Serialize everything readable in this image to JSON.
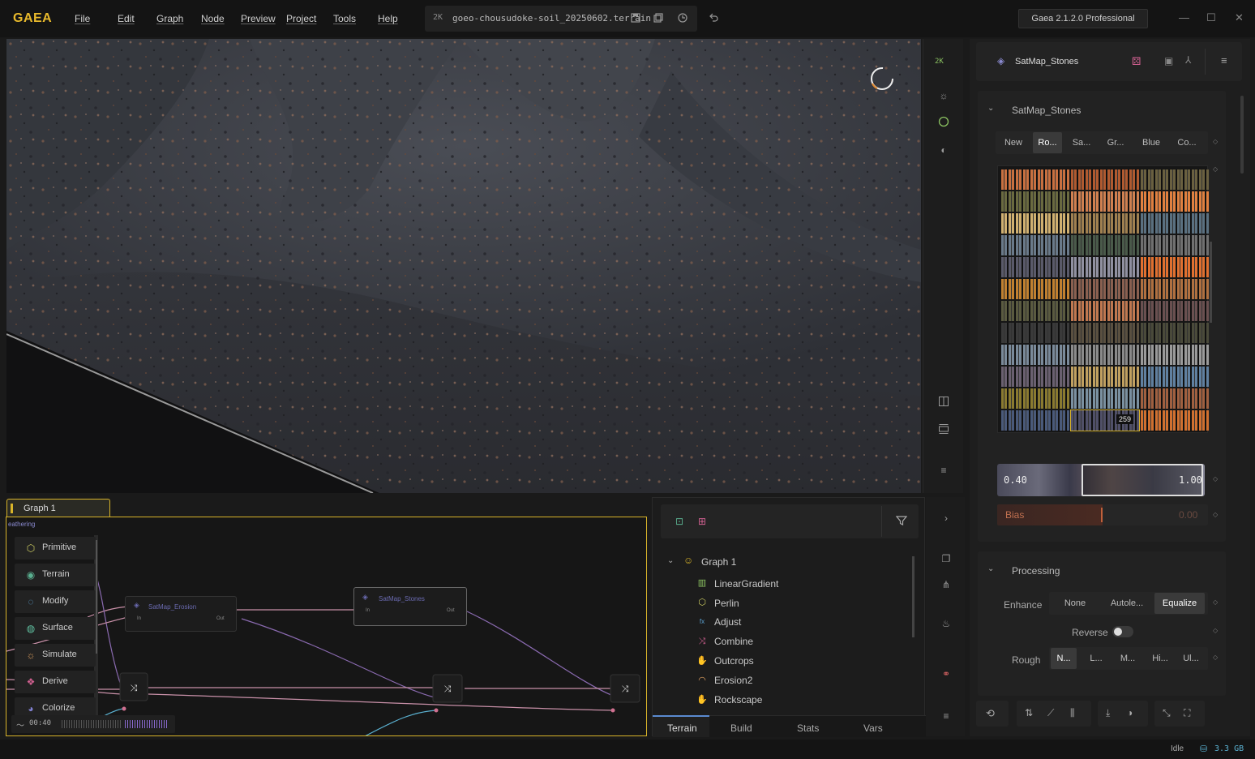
{
  "app": {
    "logo": "GAEA",
    "menu": [
      "File",
      "Edit",
      "Graph",
      "Node",
      "Preview",
      "Project",
      "Tools",
      "Help"
    ],
    "resolution_badge": "2K",
    "file_name": "goeo-chousudoke-soil_20250602.terrain",
    "version": "Gaea 2.1.2.0 Professional"
  },
  "viewport": {
    "toolbar_badge": "2K"
  },
  "graph": {
    "tab_label": "Graph 1",
    "category_header": "eathering",
    "categories": [
      {
        "label": "Primitive",
        "icon": "cube-icon",
        "color": "#c8c860"
      },
      {
        "label": "Terrain",
        "icon": "terrain-icon",
        "color": "#5ab090"
      },
      {
        "label": "Modify",
        "icon": "modify-icon",
        "color": "#5aa0d0"
      },
      {
        "label": "Surface",
        "icon": "surface-icon",
        "color": "#60c0a0"
      },
      {
        "label": "Simulate",
        "icon": "simulate-icon",
        "color": "#e0a060"
      },
      {
        "label": "Derive",
        "icon": "derive-icon",
        "color": "#d06090"
      },
      {
        "label": "Colorize",
        "icon": "colorize-icon",
        "color": "#8080d0"
      }
    ],
    "nodes": [
      {
        "title": "SatMap_Erosion",
        "in": "In",
        "out": "Out"
      },
      {
        "title": "SatMap_Stones",
        "in": "In",
        "out": "Out"
      }
    ],
    "timer": "00:40"
  },
  "tree": {
    "root": "Graph 1",
    "items": [
      {
        "label": "LinearGradient",
        "icon": "gradient-icon",
        "color": "#8ac060"
      },
      {
        "label": "Perlin",
        "icon": "hexagon-icon",
        "color": "#c8c860"
      },
      {
        "label": "Adjust",
        "icon": "fx-icon",
        "color": "#5aa0d0"
      },
      {
        "label": "Combine",
        "icon": "combine-icon",
        "color": "#d06090"
      },
      {
        "label": "Outcrops",
        "icon": "hand-icon",
        "color": "#5ab090"
      },
      {
        "label": "Erosion2",
        "icon": "erosion-icon",
        "color": "#e0a060"
      },
      {
        "label": "Rockscape",
        "icon": "hand-icon",
        "color": "#5ab090"
      }
    ],
    "tabs": [
      "Terrain",
      "Build",
      "Stats",
      "Vars"
    ]
  },
  "properties": {
    "node_title": "SatMap_Stones",
    "section_title": "SatMap_Stones",
    "library_tabs": [
      "New",
      "Ro...",
      "Sa...",
      "Gr...",
      "Blue",
      "Co..."
    ],
    "active_library_tab": 1,
    "selected_swatch_label": "259",
    "range_min": "0.40",
    "range_max": "1.00",
    "bias_label": "Bias",
    "bias_value": "0.00",
    "processing_title": "Processing",
    "enhance_label": "Enhance",
    "enhance_options": [
      "None",
      "Autole...",
      "Equalize"
    ],
    "enhance_active": 2,
    "reverse_label": "Reverse",
    "rough_label": "Rough",
    "rough_options": [
      "N...",
      "L...",
      "M...",
      "Hi...",
      "Ul..."
    ],
    "rough_active": 0
  },
  "status": {
    "state": "Idle",
    "memory": "3.3 GB"
  },
  "palette_colors": [
    [
      "#c87040",
      "#b05a30",
      "#6a6040"
    ],
    [
      "#6a6a40",
      "#d08050",
      "#e08040"
    ],
    [
      "#d0b070",
      "#a08050",
      "#5a7080"
    ],
    [
      "#6a7a8a",
      "#4a5a4a",
      "#707070"
    ],
    [
      "#5a5a6a",
      "#9090a0",
      "#e07030"
    ],
    [
      "#c08030",
      "#8a6050",
      "#b07040"
    ],
    [
      "#5a5a40",
      "#c07850",
      "#6a5050"
    ],
    [
      "#3a3a3a",
      "#5a5040",
      "#4a4a3a"
    ],
    [
      "#7a8a9a",
      "#8a8a8a",
      "#9a9a9a"
    ],
    [
      "#6a6070",
      "#c0a060",
      "#6080a0"
    ],
    [
      "#8a7a30",
      "#7a90a0",
      "#a06040"
    ],
    [
      "#4a5a7a",
      "#505068",
      "#d07030"
    ]
  ]
}
